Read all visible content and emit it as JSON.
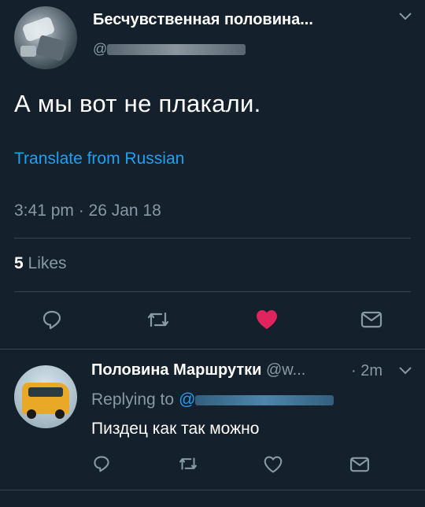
{
  "main_tweet": {
    "display_name": "Бесчувственная половина...",
    "handle_prefix": "@",
    "text": "А мы вот не плакали.",
    "translate_label": "Translate from Russian",
    "timestamp": "3:41 pm · 26 Jan 18",
    "likes_count": "5",
    "likes_label": "Likes",
    "liked": true
  },
  "reply_tweet": {
    "display_name": "Половина Маршрутки",
    "handle": "@w...",
    "time": "· 2m",
    "replying_label": "Replying to",
    "replying_prefix": "@",
    "text": "Пиздец как так можно"
  },
  "colors": {
    "background": "#14202b",
    "accent": "#1da1f2",
    "like": "#e0245e",
    "muted": "#8899a6",
    "divider": "#38444d"
  },
  "icons": [
    "chevron-down-icon",
    "reply-icon",
    "retweet-icon",
    "like-icon",
    "direct-message-icon"
  ]
}
